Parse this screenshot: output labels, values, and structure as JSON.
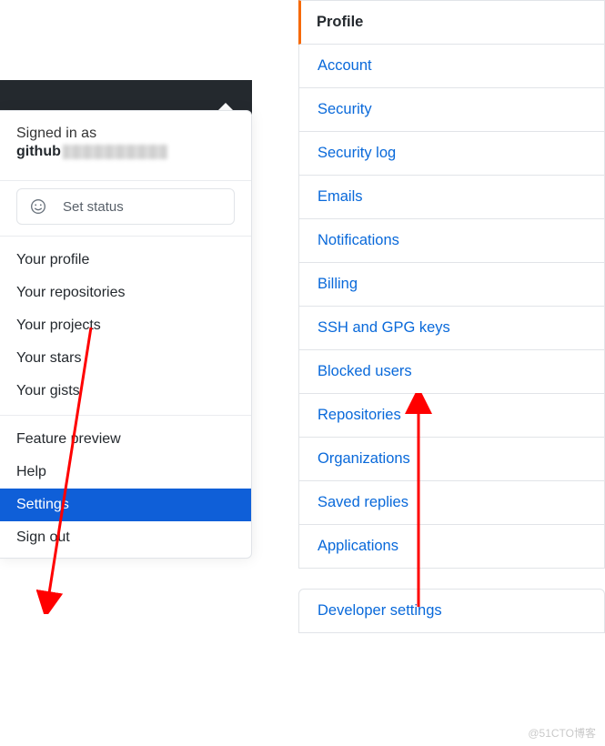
{
  "dropdown": {
    "signed_in_label": "Signed in as",
    "username_prefix": "github",
    "set_status_label": "Set status",
    "items_group1": [
      {
        "label": "Your profile"
      },
      {
        "label": "Your repositories"
      },
      {
        "label": "Your projects"
      },
      {
        "label": "Your stars"
      },
      {
        "label": "Your gists"
      }
    ],
    "items_group2": [
      {
        "label": "Feature preview"
      },
      {
        "label": "Help"
      },
      {
        "label": "Settings",
        "highlight": true
      },
      {
        "label": "Sign out"
      }
    ]
  },
  "sidebar": {
    "items": [
      {
        "label": "Profile",
        "active": true
      },
      {
        "label": "Account"
      },
      {
        "label": "Security"
      },
      {
        "label": "Security log"
      },
      {
        "label": "Emails"
      },
      {
        "label": "Notifications"
      },
      {
        "label": "Billing"
      },
      {
        "label": "SSH and GPG keys"
      },
      {
        "label": "Blocked users"
      },
      {
        "label": "Repositories"
      },
      {
        "label": "Organizations"
      },
      {
        "label": "Saved replies"
      },
      {
        "label": "Applications"
      }
    ],
    "dev_label": "Developer settings"
  },
  "watermark": "@51CTO博客",
  "colors": {
    "link": "#0969da",
    "highlight": "#0f5fd8",
    "active_border": "#f66a0a",
    "annotation": "#ff0000"
  }
}
